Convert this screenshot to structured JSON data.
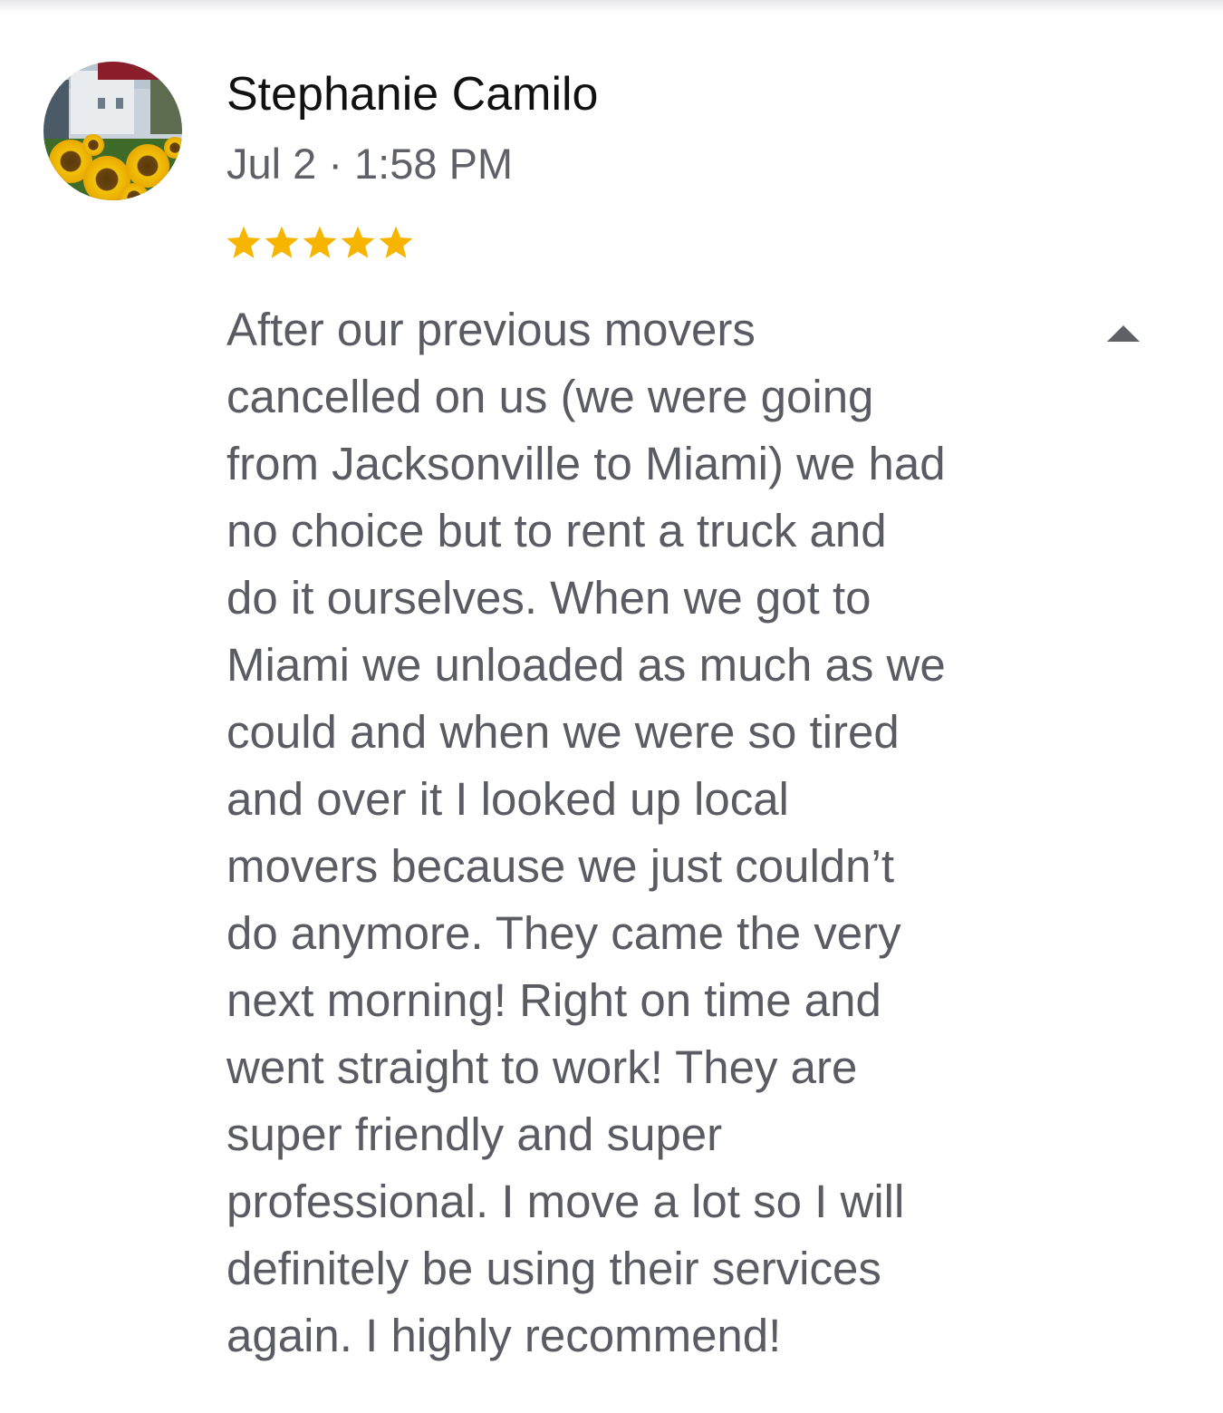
{
  "review": {
    "reviewer_name": "Stephanie Camilo",
    "date": "Jul 2 · 1:58 PM",
    "rating": 5,
    "rating_max": 5,
    "star_color": "#f7b500",
    "text_lines": [
      "After our previous movers",
      "cancelled on us (we were going",
      "from Jacksonville to Miami) we had",
      "no choice but to rent a truck and",
      "do it ourselves. When we got to",
      "Miami we unloaded as much as we",
      "could and when we were so tired",
      "and over it I looked up local",
      "movers because we just couldn’t",
      "do anymore. They came the very",
      "next morning! Right on time and",
      "went straight to work! They are",
      "super friendly and super",
      "professional. I move a lot so I will",
      "definitely be using their services",
      "again. I highly recommend!"
    ],
    "collapse_icon": "caret-up-icon",
    "avatar_icon": "sunflower-photo"
  }
}
